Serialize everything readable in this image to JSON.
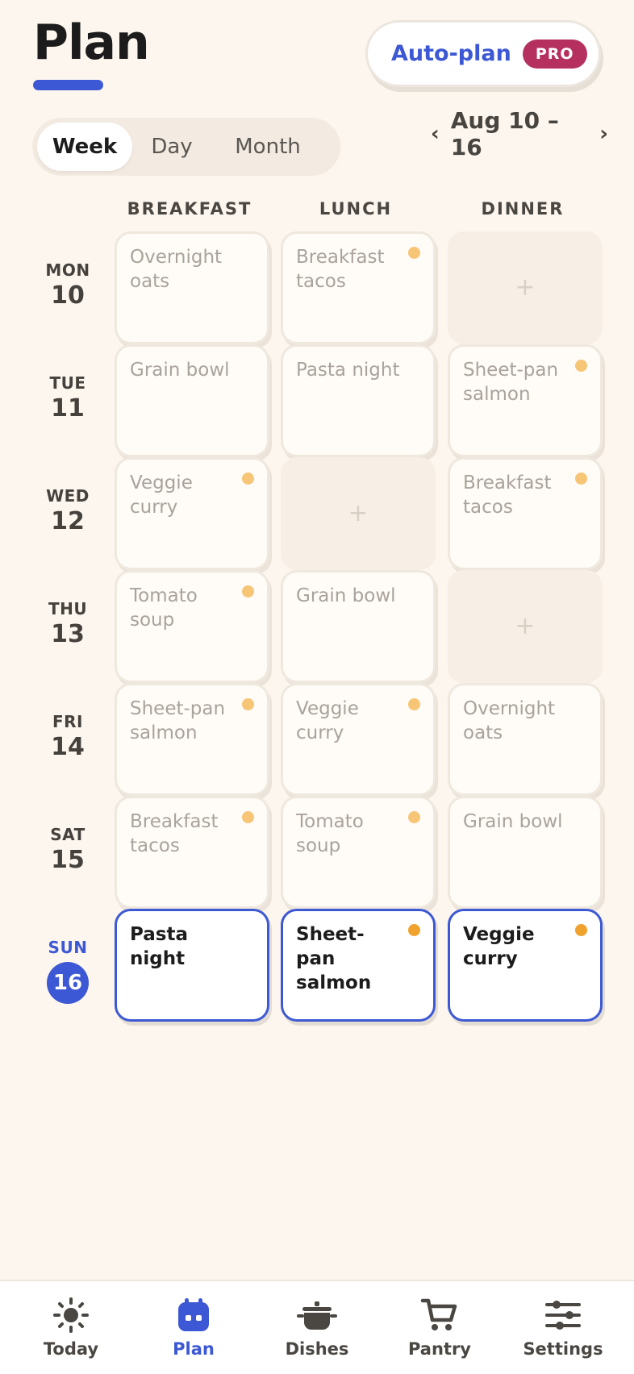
{
  "header": {
    "title": "Plan",
    "autoplan_label": "Auto-plan",
    "pro_badge": "PRO"
  },
  "view_toggle": {
    "options": [
      "Week",
      "Day",
      "Month"
    ],
    "selected": "Week"
  },
  "date_range": {
    "label": "Aug 10 – 16",
    "prev": "‹",
    "next": "›"
  },
  "columns": [
    "BREAKFAST",
    "LUNCH",
    "DINNER"
  ],
  "add_glyph": "+",
  "days": [
    {
      "name": "MON",
      "num": "10",
      "meals": [
        {
          "label": "Overnight oats",
          "dot": false
        },
        {
          "label": "Breakfast tacos",
          "dot": true
        },
        null
      ]
    },
    {
      "name": "TUE",
      "num": "11",
      "meals": [
        {
          "label": "Grain bowl",
          "dot": false
        },
        {
          "label": "Pasta night",
          "dot": false
        },
        {
          "label": "Sheet-pan salmon",
          "dot": true
        }
      ]
    },
    {
      "name": "WED",
      "num": "12",
      "meals": [
        {
          "label": "Veggie curry",
          "dot": true
        },
        null,
        {
          "label": "Breakfast tacos",
          "dot": true
        }
      ]
    },
    {
      "name": "THU",
      "num": "13",
      "meals": [
        {
          "label": "Tomato soup",
          "dot": true
        },
        {
          "label": "Grain bowl",
          "dot": false
        },
        null
      ]
    },
    {
      "name": "FRI",
      "num": "14",
      "meals": [
        {
          "label": "Sheet-pan salmon",
          "dot": true
        },
        {
          "label": "Veggie curry",
          "dot": true
        },
        {
          "label": "Overnight oats",
          "dot": false
        }
      ]
    },
    {
      "name": "SAT",
      "num": "15",
      "meals": [
        {
          "label": "Breakfast tacos",
          "dot": true
        },
        {
          "label": "Tomato soup",
          "dot": true
        },
        {
          "label": "Grain bowl",
          "dot": false
        }
      ]
    },
    {
      "name": "SUN",
      "num": "16",
      "today": true,
      "meals": [
        {
          "label": "Pasta night",
          "dot": false
        },
        {
          "label": "Sheet-pan salmon",
          "dot": true
        },
        {
          "label": "Veggie curry",
          "dot": true
        }
      ]
    }
  ],
  "tabs": [
    {
      "label": "Today",
      "icon": "sun-icon"
    },
    {
      "label": "Plan",
      "icon": "calendar-icon",
      "active": true
    },
    {
      "label": "Dishes",
      "icon": "pot-icon"
    },
    {
      "label": "Pantry",
      "icon": "cart-icon"
    },
    {
      "label": "Settings",
      "icon": "sliders-icon"
    }
  ],
  "colors": {
    "accent": "#3d58d4",
    "pro": "#b6305f",
    "dot": "#f6c576",
    "dot_today": "#f0a22e",
    "background": "#fdf6ee"
  }
}
